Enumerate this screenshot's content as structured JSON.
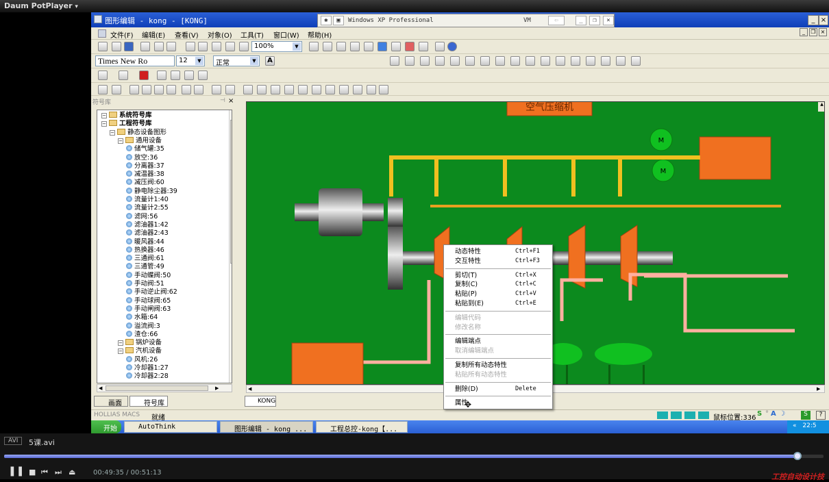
{
  "player": {
    "brand": "Daum PotPlayer",
    "format_badge": "AVI",
    "filename": "5课.avi",
    "time_current": "00:49:35",
    "time_total": "00:51:13",
    "progress_fraction": 0.968,
    "watermark": "工控自动设计技"
  },
  "window": {
    "title": "图形编辑 - kong - [KONG]",
    "vm_title": "Windows XP Professional",
    "vm_label": "VM"
  },
  "menu": [
    "文件(F)",
    "编辑(E)",
    "查看(V)",
    "对象(O)",
    "工具(T)",
    "窗口(W)",
    "帮助(H)"
  ],
  "toolbar": {
    "zoom": "100%",
    "font": "Times New Ro",
    "font_size": "12",
    "style": "正常"
  },
  "library": {
    "panel_title": "符号库",
    "nodes": [
      {
        "label": "系统符号库",
        "level": 0,
        "kind": "folder",
        "bold": true
      },
      {
        "label": "工程符号库",
        "level": 0,
        "kind": "folder",
        "bold": true
      },
      {
        "label": "静态设备图形",
        "level": 1,
        "kind": "folder"
      },
      {
        "label": "通用设备",
        "level": 2,
        "kind": "folder"
      },
      {
        "label": "储气罐:35",
        "level": 3,
        "kind": "item"
      },
      {
        "label": "放空:36",
        "level": 3,
        "kind": "item"
      },
      {
        "label": "分离器:37",
        "level": 3,
        "kind": "item"
      },
      {
        "label": "减温器:38",
        "level": 3,
        "kind": "item"
      },
      {
        "label": "减压阀:60",
        "level": 3,
        "kind": "item"
      },
      {
        "label": "静电除尘器:39",
        "level": 3,
        "kind": "item"
      },
      {
        "label": "流量计1:40",
        "level": 3,
        "kind": "item"
      },
      {
        "label": "流量计2:55",
        "level": 3,
        "kind": "item"
      },
      {
        "label": "滤网:56",
        "level": 3,
        "kind": "item"
      },
      {
        "label": "滤油器1:42",
        "level": 3,
        "kind": "item"
      },
      {
        "label": "滤油器2:43",
        "level": 3,
        "kind": "item"
      },
      {
        "label": "暖风器:44",
        "level": 3,
        "kind": "item"
      },
      {
        "label": "热换器:46",
        "level": 3,
        "kind": "item"
      },
      {
        "label": "三通阀:61",
        "level": 3,
        "kind": "item"
      },
      {
        "label": "三通管:49",
        "level": 3,
        "kind": "item"
      },
      {
        "label": "手动蝶阀:50",
        "level": 3,
        "kind": "item"
      },
      {
        "label": "手动阀:51",
        "level": 3,
        "kind": "item"
      },
      {
        "label": "手动逆止阀:62",
        "level": 3,
        "kind": "item"
      },
      {
        "label": "手动球阀:65",
        "level": 3,
        "kind": "item"
      },
      {
        "label": "手动闸阀:63",
        "level": 3,
        "kind": "item"
      },
      {
        "label": "水箱:64",
        "level": 3,
        "kind": "item"
      },
      {
        "label": "溢流阀:3",
        "level": 3,
        "kind": "item"
      },
      {
        "label": "渣仓:66",
        "level": 3,
        "kind": "item"
      },
      {
        "label": "锅炉设备",
        "level": 2,
        "kind": "folder"
      },
      {
        "label": "汽机设备",
        "level": 2,
        "kind": "folder"
      },
      {
        "label": "风机:26",
        "level": 3,
        "kind": "item"
      },
      {
        "label": "冷却器1:27",
        "level": 3,
        "kind": "item"
      },
      {
        "label": "冷却器2:28",
        "level": 3,
        "kind": "item"
      }
    ],
    "tabs": [
      "画面",
      "符号库"
    ]
  },
  "canvas": {
    "title_box": "空气压缩机",
    "motor_label": "M",
    "tab": "KONG",
    "colors": {
      "background": "#0c8a1e",
      "equipment": "#f07020",
      "pipe_yellow": "#f0c020",
      "motor": "#10c020"
    }
  },
  "context_menu": [
    {
      "label": "动态特性",
      "shortcut": "Ctrl+F1",
      "disabled": false
    },
    {
      "label": "交互特性",
      "shortcut": "Ctrl+F3",
      "disabled": false
    },
    {
      "sep": true
    },
    {
      "label": "剪切(T)",
      "shortcut": "Ctrl+X",
      "disabled": false
    },
    {
      "label": "复制(C)",
      "shortcut": "Ctrl+C",
      "disabled": false
    },
    {
      "label": "粘贴(P)",
      "shortcut": "Ctrl+V",
      "disabled": false
    },
    {
      "label": "粘贴到(E)",
      "shortcut": "Ctrl+E",
      "disabled": false
    },
    {
      "sep": true
    },
    {
      "label": "编辑代码",
      "shortcut": "",
      "disabled": true
    },
    {
      "label": "修改名称",
      "shortcut": "",
      "disabled": true
    },
    {
      "sep": true
    },
    {
      "label": "编辑端点",
      "shortcut": "",
      "disabled": false
    },
    {
      "label": "取消编辑端点",
      "shortcut": "",
      "disabled": true
    },
    {
      "sep": true
    },
    {
      "label": "复制所有动态特性",
      "shortcut": "",
      "disabled": false
    },
    {
      "label": "粘贴所有动态特性",
      "shortcut": "",
      "disabled": true
    },
    {
      "sep": true
    },
    {
      "label": "删除(D)",
      "shortcut": "Delete",
      "disabled": false
    },
    {
      "sep": true
    },
    {
      "label": "属性",
      "shortcut": "",
      "disabled": false
    }
  ],
  "status": {
    "left_logo": "HOLLIAS MACS",
    "ready": "就绪",
    "mouse_pos": "鼠标位置:336"
  },
  "taskbar": {
    "start": "开始",
    "tasks": [
      "AutoThink",
      "图形编辑 - kong ...",
      "工程总控-kong【..."
    ],
    "clock": "22:5"
  }
}
